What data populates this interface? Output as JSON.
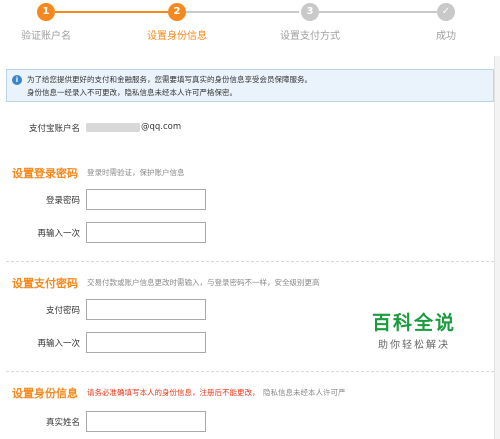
{
  "steps": [
    {
      "number": "1",
      "label": "验证账户名",
      "state": "done"
    },
    {
      "number": "2",
      "label": "设置身份信息",
      "state": "current"
    },
    {
      "number": "3",
      "label": "设置支付方式",
      "state": "pending"
    },
    {
      "number": "✓",
      "label": "成功",
      "state": "pending"
    }
  ],
  "notice": {
    "line1": "为了给您提供更好的支付和金融服务，您需要填写真实的身份信息享受会员保障服务。",
    "line2": "身份信息一经录入不可更改，隐私信息未经本人许可严格保密。"
  },
  "account": {
    "label": "支付宝账户名",
    "value_suffix": "@qq.com"
  },
  "login_password": {
    "title": "设置登录密码",
    "desc": "登录时需验证，保护账户信息",
    "field1_label": "登录密码",
    "field2_label": "再输入一次"
  },
  "pay_password": {
    "title": "设置支付密码",
    "desc": "交易付款或账户信息更改时需输入，与登录密码不一样，安全级别更高",
    "field1_label": "支付密码",
    "field2_label": "再输入一次"
  },
  "identity": {
    "title": "设置身份信息",
    "desc_warn": "请务必准确填写本人的身份信息，注册后不能更改，",
    "desc_rest": "隐私信息未经本人许可严",
    "field1_label": "真实姓名"
  },
  "watermark": {
    "title": "百科全说",
    "subtitle": "助你轻松解决"
  },
  "colors": {
    "accent": "#f5891f",
    "inactive": "#c9c9c9",
    "notice_bg": "#eaf3fb",
    "warn": "#e8381a",
    "watermark": "#1a9c3e"
  }
}
